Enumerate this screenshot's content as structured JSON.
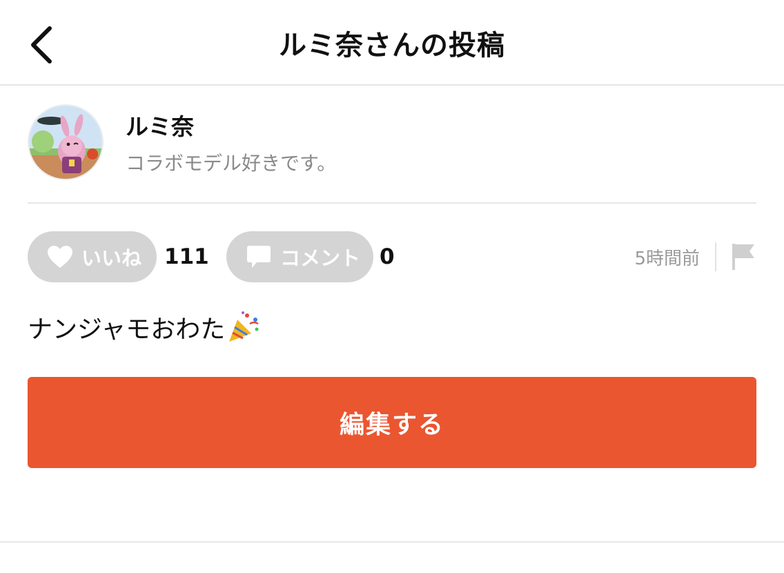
{
  "header": {
    "title": "ルミ奈さんの投稿",
    "back_icon": "chevron-left-icon"
  },
  "profile": {
    "username": "ルミ奈",
    "bio": "コラボモデル好きです。",
    "avatar_icon": "avatar-illustration"
  },
  "actions": {
    "like_label": "いいね",
    "like_count": "111",
    "like_icon": "heart-icon",
    "comment_label": "コメント",
    "comment_count": "0",
    "comment_icon": "speech-bubble-icon",
    "timestamp": "5時間前",
    "report_icon": "flag-icon"
  },
  "post": {
    "text": "ナンジャモおわた",
    "emoji_icon": "party-popper-icon"
  },
  "edit_button": {
    "label": "編集する"
  },
  "colors": {
    "accent": "#ea5630",
    "pill_bg": "#d4d4d4",
    "muted_text": "#8a8a8a",
    "divider": "#e6e6e6"
  }
}
